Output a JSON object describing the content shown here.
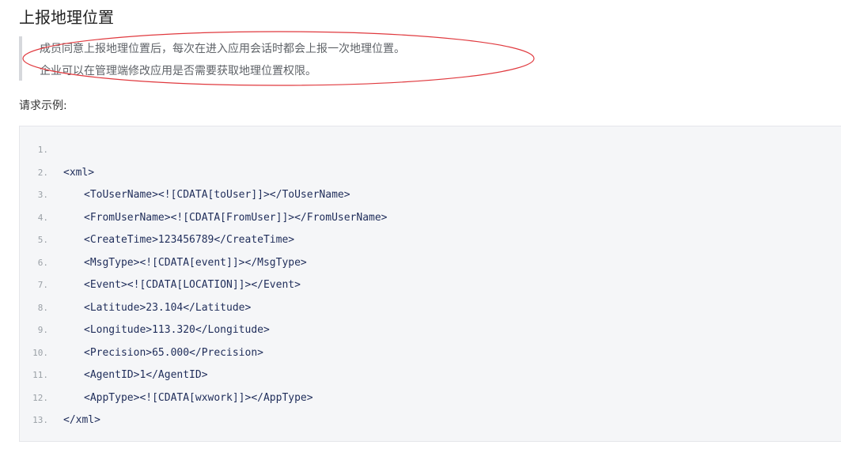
{
  "section": {
    "title": "上报地理位置"
  },
  "note": {
    "lines": [
      "成员同意上报地理位置后，每次在进入应用会话时都会上报一次地理位置。",
      "企业可以在管理端修改应用是否需要获取地理位置权限。"
    ]
  },
  "annotation": {
    "color": "#e0393e"
  },
  "request_example": {
    "label": "请求示例:"
  },
  "code": {
    "lines": [
      {
        "num": "1.",
        "indent": 0,
        "text": ""
      },
      {
        "num": "2.",
        "indent": 0,
        "text": "<xml>"
      },
      {
        "num": "3.",
        "indent": 1,
        "text": "<ToUserName><![CDATA[toUser]]></ToUserName>"
      },
      {
        "num": "4.",
        "indent": 1,
        "text": "<FromUserName><![CDATA[FromUser]]></FromUserName>"
      },
      {
        "num": "5.",
        "indent": 1,
        "text": "<CreateTime>123456789</CreateTime>"
      },
      {
        "num": "6.",
        "indent": 1,
        "text": "<MsgType><![CDATA[event]]></MsgType>"
      },
      {
        "num": "7.",
        "indent": 1,
        "text": "<Event><![CDATA[LOCATION]]></Event>"
      },
      {
        "num": "8.",
        "indent": 1,
        "text": "<Latitude>23.104</Latitude>"
      },
      {
        "num": "9.",
        "indent": 1,
        "text": "<Longitude>113.320</Longitude>"
      },
      {
        "num": "10.",
        "indent": 1,
        "text": "<Precision>65.000</Precision>"
      },
      {
        "num": "11.",
        "indent": 1,
        "text": "<AgentID>1</AgentID>"
      },
      {
        "num": "12.",
        "indent": 1,
        "text": "<AppType><![CDATA[wxwork]]></AppType>"
      },
      {
        "num": "13.",
        "indent": 0,
        "text": "</xml>"
      }
    ]
  }
}
